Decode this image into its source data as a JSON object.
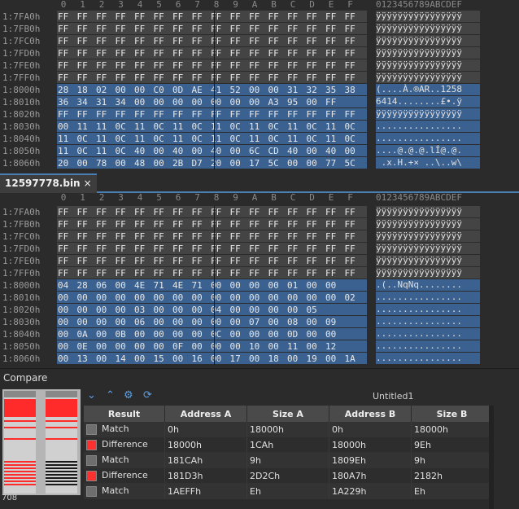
{
  "editor_top": {
    "header": [
      "0",
      "1",
      "2",
      "3",
      "4",
      "5",
      "6",
      "7",
      "8",
      "9",
      "A",
      "B",
      "C",
      "D",
      "E",
      "F"
    ],
    "ascii_header": "0123456789ABCDEF",
    "rows": [
      {
        "addr": "1:7FA0h",
        "bytes": [
          "FF",
          "FF",
          "FF",
          "FF",
          "FF",
          "FF",
          "FF",
          "FF",
          "FF",
          "FF",
          "FF",
          "FF",
          "FF",
          "FF",
          "FF",
          "FF"
        ],
        "ascii": "ÿÿÿÿÿÿÿÿÿÿÿÿÿÿÿÿ",
        "state": "ff"
      },
      {
        "addr": "1:7FB0h",
        "bytes": [
          "FF",
          "FF",
          "FF",
          "FF",
          "FF",
          "FF",
          "FF",
          "FF",
          "FF",
          "FF",
          "FF",
          "FF",
          "FF",
          "FF",
          "FF",
          "FF"
        ],
        "ascii": "ÿÿÿÿÿÿÿÿÿÿÿÿÿÿÿÿ",
        "state": "ff"
      },
      {
        "addr": "1:7FC0h",
        "bytes": [
          "FF",
          "FF",
          "FF",
          "FF",
          "FF",
          "FF",
          "FF",
          "FF",
          "FF",
          "FF",
          "FF",
          "FF",
          "FF",
          "FF",
          "FF",
          "FF"
        ],
        "ascii": "ÿÿÿÿÿÿÿÿÿÿÿÿÿÿÿÿ",
        "state": "ff"
      },
      {
        "addr": "1:7FD0h",
        "bytes": [
          "FF",
          "FF",
          "FF",
          "FF",
          "FF",
          "FF",
          "FF",
          "FF",
          "FF",
          "FF",
          "FF",
          "FF",
          "FF",
          "FF",
          "FF",
          "FF"
        ],
        "ascii": "ÿÿÿÿÿÿÿÿÿÿÿÿÿÿÿÿ",
        "state": "ff"
      },
      {
        "addr": "1:7FE0h",
        "bytes": [
          "FF",
          "FF",
          "FF",
          "FF",
          "FF",
          "FF",
          "FF",
          "FF",
          "FF",
          "FF",
          "FF",
          "FF",
          "FF",
          "FF",
          "FF",
          "FF"
        ],
        "ascii": "ÿÿÿÿÿÿÿÿÿÿÿÿÿÿÿÿ",
        "state": "ff"
      },
      {
        "addr": "1:7FF0h",
        "bytes": [
          "FF",
          "FF",
          "FF",
          "FF",
          "FF",
          "FF",
          "FF",
          "FF",
          "FF",
          "FF",
          "FF",
          "FF",
          "FF",
          "FF",
          "FF",
          "FF"
        ],
        "ascii": "ÿÿÿÿÿÿÿÿÿÿÿÿÿÿÿÿ",
        "state": "ff"
      },
      {
        "addr": "1:8000h",
        "bytes": [
          "28",
          "18",
          "02",
          "00",
          "00",
          "C0",
          "0D",
          "AE",
          "41",
          "52",
          "00",
          "00",
          "31",
          "32",
          "35",
          "38"
        ],
        "ascii": "(....À.®AR..1258",
        "state": "sel"
      },
      {
        "addr": "1:8010h",
        "bytes": [
          "36",
          "34",
          "31",
          "34",
          "00",
          "00",
          "00",
          "00",
          "00",
          "00",
          "00",
          "A3",
          "95",
          "00",
          "FF"
        ],
        "ascii": "6414........£•.ÿ",
        "state": "sel"
      },
      {
        "addr": "1:8020h",
        "bytes": [
          "FF",
          "FF",
          "FF",
          "FF",
          "FF",
          "FF",
          "FF",
          "FF",
          "FF",
          "FF",
          "FF",
          "FF",
          "FF",
          "FF",
          "FF",
          "FF"
        ],
        "ascii": "ÿÿÿÿÿÿÿÿÿÿÿÿÿÿÿÿ",
        "state": "sel"
      },
      {
        "addr": "1:8030h",
        "bytes": [
          "00",
          "11",
          "11",
          "0C",
          "11",
          "0C",
          "11",
          "0C",
          "11",
          "0C",
          "11",
          "0C",
          "11",
          "0C",
          "11",
          "0C"
        ],
        "ascii": "................",
        "state": "sel"
      },
      {
        "addr": "1:8040h",
        "bytes": [
          "11",
          "0C",
          "11",
          "0C",
          "11",
          "0C",
          "11",
          "0C",
          "11",
          "0C",
          "11",
          "0C",
          "11",
          "0C",
          "11",
          "0C"
        ],
        "ascii": "................",
        "state": "sel"
      },
      {
        "addr": "1:8050h",
        "bytes": [
          "11",
          "0C",
          "11",
          "0C",
          "40",
          "00",
          "40",
          "00",
          "40",
          "00",
          "6C",
          "CD",
          "40",
          "00",
          "40",
          "00"
        ],
        "ascii": "....@.@.@.lÍ@.@.",
        "state": "sel"
      },
      {
        "addr": "1:8060h",
        "bytes": [
          "20",
          "00",
          "78",
          "00",
          "48",
          "00",
          "2B",
          "D7",
          "20",
          "00",
          "17",
          "5C",
          "00",
          "00",
          "77",
          "5C"
        ],
        "ascii": " .x.H.+× ..\\..w\\",
        "state": "sel"
      }
    ]
  },
  "tab": {
    "filename": "12597778.bin",
    "close": "×"
  },
  "editor_bottom": {
    "header": [
      "0",
      "1",
      "2",
      "3",
      "4",
      "5",
      "6",
      "7",
      "8",
      "9",
      "A",
      "B",
      "C",
      "D",
      "E",
      "F"
    ],
    "ascii_header": "0123456789ABCDEF",
    "rows": [
      {
        "addr": "1:7FA0h",
        "bytes": [
          "FF",
          "FF",
          "FF",
          "FF",
          "FF",
          "FF",
          "FF",
          "FF",
          "FF",
          "FF",
          "FF",
          "FF",
          "FF",
          "FF",
          "FF",
          "FF"
        ],
        "ascii": "ÿÿÿÿÿÿÿÿÿÿÿÿÿÿÿÿ",
        "state": "ff"
      },
      {
        "addr": "1:7FB0h",
        "bytes": [
          "FF",
          "FF",
          "FF",
          "FF",
          "FF",
          "FF",
          "FF",
          "FF",
          "FF",
          "FF",
          "FF",
          "FF",
          "FF",
          "FF",
          "FF",
          "FF"
        ],
        "ascii": "ÿÿÿÿÿÿÿÿÿÿÿÿÿÿÿÿ",
        "state": "ff"
      },
      {
        "addr": "1:7FC0h",
        "bytes": [
          "FF",
          "FF",
          "FF",
          "FF",
          "FF",
          "FF",
          "FF",
          "FF",
          "FF",
          "FF",
          "FF",
          "FF",
          "FF",
          "FF",
          "FF",
          "FF"
        ],
        "ascii": "ÿÿÿÿÿÿÿÿÿÿÿÿÿÿÿÿ",
        "state": "ff"
      },
      {
        "addr": "1:7FD0h",
        "bytes": [
          "FF",
          "FF",
          "FF",
          "FF",
          "FF",
          "FF",
          "FF",
          "FF",
          "FF",
          "FF",
          "FF",
          "FF",
          "FF",
          "FF",
          "FF",
          "FF"
        ],
        "ascii": "ÿÿÿÿÿÿÿÿÿÿÿÿÿÿÿÿ",
        "state": "ff"
      },
      {
        "addr": "1:7FE0h",
        "bytes": [
          "FF",
          "FF",
          "FF",
          "FF",
          "FF",
          "FF",
          "FF",
          "FF",
          "FF",
          "FF",
          "FF",
          "FF",
          "FF",
          "FF",
          "FF",
          "FF"
        ],
        "ascii": "ÿÿÿÿÿÿÿÿÿÿÿÿÿÿÿÿ",
        "state": "ff"
      },
      {
        "addr": "1:7FF0h",
        "bytes": [
          "FF",
          "FF",
          "FF",
          "FF",
          "FF",
          "FF",
          "FF",
          "FF",
          "FF",
          "FF",
          "FF",
          "FF",
          "FF",
          "FF",
          "FF",
          "FF"
        ],
        "ascii": "ÿÿÿÿÿÿÿÿÿÿÿÿÿÿÿÿ",
        "state": "ff"
      },
      {
        "addr": "1:8000h",
        "bytes": [
          "04",
          "28",
          "06",
          "00",
          "4E",
          "71",
          "4E",
          "71",
          "00",
          "00",
          "00",
          "00",
          "01",
          "00",
          "00"
        ],
        "ascii": ".(..NqNq........",
        "state": "sel"
      },
      {
        "addr": "1:8010h",
        "bytes": [
          "00",
          "00",
          "00",
          "00",
          "00",
          "00",
          "00",
          "00",
          "00",
          "00",
          "00",
          "00",
          "00",
          "00",
          "00",
          "02"
        ],
        "ascii": "................",
        "state": "sel"
      },
      {
        "addr": "1:8020h",
        "bytes": [
          "00",
          "00",
          "00",
          "00",
          "03",
          "00",
          "00",
          "00",
          "04",
          "00",
          "00",
          "00",
          "00",
          "05"
        ],
        "ascii": "................",
        "state": "sel"
      },
      {
        "addr": "1:8030h",
        "bytes": [
          "00",
          "00",
          "00",
          "00",
          "06",
          "00",
          "00",
          "00",
          "00",
          "00",
          "07",
          "00",
          "08",
          "00",
          "09"
        ],
        "ascii": "................",
        "state": "sel"
      },
      {
        "addr": "1:8040h",
        "bytes": [
          "00",
          "0A",
          "00",
          "0B",
          "00",
          "00",
          "00",
          "00",
          "0C",
          "00",
          "00",
          "00",
          "0D",
          "00",
          "00"
        ],
        "ascii": "................",
        "state": "sel"
      },
      {
        "addr": "1:8050h",
        "bytes": [
          "00",
          "0E",
          "00",
          "00",
          "00",
          "00",
          "0F",
          "00",
          "00",
          "00",
          "10",
          "00",
          "11",
          "00",
          "12"
        ],
        "ascii": "................",
        "state": "sel"
      },
      {
        "addr": "1:8060h",
        "bytes": [
          "00",
          "13",
          "00",
          "14",
          "00",
          "15",
          "00",
          "16",
          "00",
          "17",
          "00",
          "18",
          "00",
          "19",
          "00",
          "1A"
        ],
        "ascii": "................",
        "state": "sel"
      }
    ]
  },
  "compare": {
    "title": "Compare",
    "minimap_label": "708",
    "toolbar": [
      "chevron-down-icon",
      "chevron-up-icon",
      "compare-options-icon",
      "refresh-icon"
    ],
    "result_name": "Untitled1",
    "columns": [
      "Result",
      "Address A",
      "Size A",
      "Address B",
      "Size B"
    ],
    "rows": [
      {
        "result": "Match",
        "color": "#6e6e6e",
        "addr_a": "0h",
        "size_a": "18000h",
        "addr_b": "0h",
        "size_b": "18000h"
      },
      {
        "result": "Difference",
        "color": "#ff3030",
        "addr_a": "18000h",
        "size_a": "1CAh",
        "addr_b": "18000h",
        "size_b": "9Eh"
      },
      {
        "result": "Match",
        "color": "#6e6e6e",
        "addr_a": "181CAh",
        "size_a": "9h",
        "addr_b": "1809Eh",
        "size_b": "9h"
      },
      {
        "result": "Difference",
        "color": "#ff3030",
        "addr_a": "181D3h",
        "size_a": "2D2Ch",
        "addr_b": "180A7h",
        "size_b": "2182h"
      },
      {
        "result": "Match",
        "color": "#6e6e6e",
        "addr_a": "1AEFFh",
        "size_a": "Eh",
        "addr_b": "1A229h",
        "size_b": "Eh"
      }
    ]
  }
}
